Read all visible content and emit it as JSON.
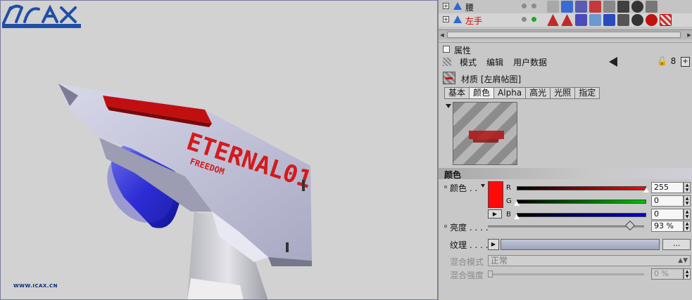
{
  "viewport": {
    "logo_text": "WWW.ICAX.CN"
  },
  "object_manager": {
    "rows": [
      {
        "name": "腰",
        "name_color": "#222222"
      },
      {
        "name": "左手",
        "name_color": "#e00000"
      }
    ]
  },
  "attributes": {
    "title": "属性",
    "menu": [
      "模式",
      "编辑",
      "用户数据"
    ],
    "material_label": "材质 [左肩帖图]",
    "tabs": [
      "基本",
      "颜色",
      "Alpha",
      "高光",
      "光照",
      "指定"
    ],
    "active_tab": "颜色",
    "section_title": "颜色",
    "color": {
      "label": "颜色 . .",
      "swatch_hex": "#ff0a0a",
      "r_letter": "R",
      "g_letter": "G",
      "b_letter": "B",
      "r": "255",
      "g": "0",
      "b": "0"
    },
    "brightness": {
      "label": "亮度 . . . .",
      "value": "93 %",
      "level_percent": 93
    },
    "texture": {
      "label": "纹理 . . . .",
      "more": "..."
    },
    "blend_mode": {
      "label": "混合模式",
      "value": "正常"
    },
    "mix_strength": {
      "label": "混合强度",
      "value": "0 %",
      "level_percent": 0
    }
  },
  "colors": {
    "accent_red": "#ff0a0a",
    "logo_blue": "#1f4fa6"
  }
}
